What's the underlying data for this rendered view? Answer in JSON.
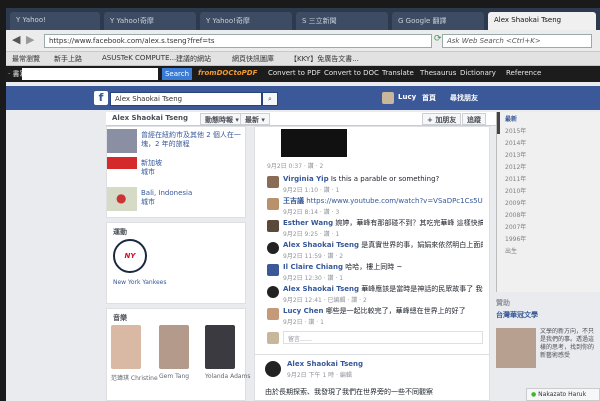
{
  "browser": {
    "tabs": [
      {
        "label": "Y Yahoo!",
        "active": false
      },
      {
        "label": "Y Yahoo!奇摩",
        "active": false
      },
      {
        "label": "Y Yahoo!奇摩",
        "active": false
      },
      {
        "label": "S 三立新聞",
        "active": false
      },
      {
        "label": "G Google 翻譯",
        "active": false
      },
      {
        "label": "Alex Shaokai Tseng",
        "active": true
      }
    ],
    "url": "https://www.facebook.com/alex.s.tseng?fref=ts",
    "web_search_placeholder": "Ask Web Search <Ctrl+K>",
    "bookmarks": [
      "最常瀏覽",
      "新手上路",
      "ASUSTeK COMPUTE...",
      "建議的網站",
      "網頁快訊圖庫",
      "【KKY】免廣告文書..."
    ],
    "toolbar": {
      "search_prefix": "· 書寫",
      "search_button": "Search",
      "brand": "fromDOCtoPDF",
      "items": [
        "Convert to PDF",
        "Convert to DOC",
        "Translate",
        "Thesaurus",
        "Dictionary",
        "Reference"
      ]
    }
  },
  "facebook": {
    "search_value": "Alex Shaokai Tseng",
    "user": "Lucy",
    "nav_home": "首頁",
    "nav_friends": "尋找朋友",
    "profile_name": "Alex Shaokai Tseng",
    "crumb_timeline": "動態時報",
    "crumb_recent": "最新",
    "add_friend": "加朋友",
    "follow": "追蹤"
  },
  "left": {
    "places": [
      {
        "text": "曾經在紐約市及其他 2 個人在一塊，2 年的旅程"
      },
      {
        "text": "新加坡\n城市"
      },
      {
        "text": "Bali, Indonesia\n城市"
      }
    ],
    "sports_title": "運動",
    "team": "New York Yankees",
    "music_title": "音樂",
    "artists": [
      "范瑋琪 Christine",
      "Gem Tang",
      "Yolanda Adams"
    ]
  },
  "feed": {
    "comments": [
      {
        "name": "Virginia Yip",
        "text": "Is this a parable or something?",
        "meta": "9月2日 1:10 · 讚 · 1"
      },
      {
        "name": "王吉議",
        "text": "https://www.youtube.com/watch?v=VSaDPc1Cs5U",
        "meta": "9月2日 8:14 · 讚 · 3"
      },
      {
        "name": "Esther Wang",
        "text": "婉婷，華峰有那部碰不到？其吃完華峰 這樣快搞作為神速魔鬼主軍應",
        "meta": "9月2日 9:25 · 讚 · 1"
      },
      {
        "name": "Alex Shaokai Tseng",
        "text": "是真實世界的事，娟娟來依然明白上面的家中",
        "meta": "9月2日 11:59 · 讚 · 2"
      },
      {
        "name": "Il Claire Chiang",
        "text": "哈哈，樓上同時 ~",
        "meta": "9月2日 12:30 · 讚 · 1"
      },
      {
        "name": "Alex Shaokai Tseng",
        "text": "華峰應該是當時是神話的民眾故事了 我們一起見",
        "meta": "9月2日 12:41 · 已編輯 · 讚 · 2"
      },
      {
        "name": "Lucy Chen",
        "text": "哪些是一起比較完了，華峰總在世界上的好了",
        "meta": "9月2日 · 讚 · 1"
      }
    ],
    "comment_placeholder": "留言……",
    "post_author": "Alex Shaokai Tseng",
    "post_meta": "9月2日 下午 1 時 · 編輯",
    "post_text": "由於長期探索、我發現了我們在世界旁的一些不同觀察"
  },
  "right": {
    "latest_label": "最新",
    "years": [
      "2015年",
      "2014年",
      "2013年",
      "2012年",
      "2011年",
      "2010年",
      "2009年",
      "2008年",
      "2007年",
      "1996年",
      "出生"
    ],
    "sponsor_title": "贊助",
    "ad_title": "台灣華冠文學",
    "ad_text": "文學的新方向，不只是我們的事。透過這樣的思考，找到你的新藝術感受"
  },
  "footer": {
    "chat_user": "Nakazato Haruk"
  },
  "colors": {
    "fb_blue": "#3b5998",
    "link": "#365899"
  }
}
